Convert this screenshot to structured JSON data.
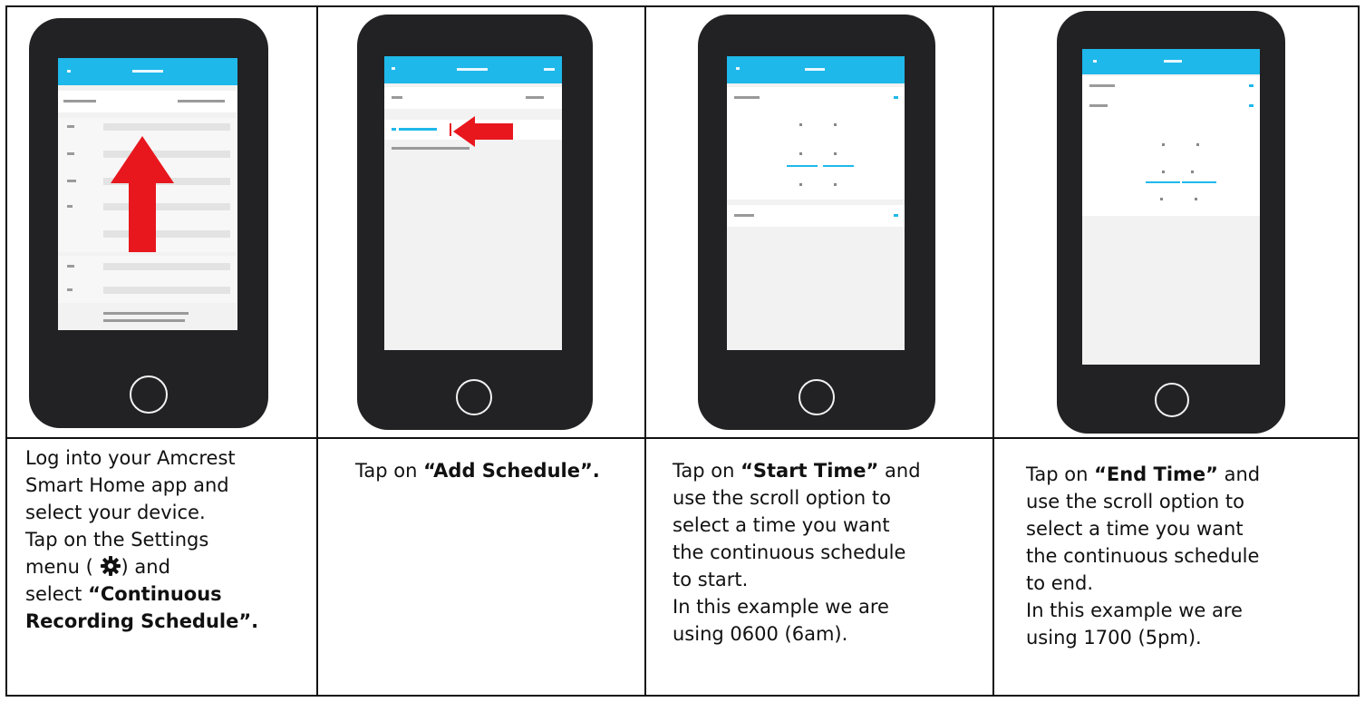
{
  "steps": [
    {
      "caption_lines": [
        [
          "Log into your Amcrest",
          ""
        ],
        [
          "Smart Home app and",
          ""
        ],
        [
          "select your device.",
          ""
        ],
        [
          "Tap on the Settings",
          ""
        ],
        [
          "menu ( ",
          "",
          "gear",
          ") and"
        ],
        [
          "select ",
          "“Continuous"
        ],
        [
          "",
          "Recording Schedule”."
        ]
      ]
    },
    {
      "caption_lines": [
        [
          "Tap on ",
          "“Add Schedule”."
        ]
      ]
    },
    {
      "caption_lines": [
        [
          "Tap on ",
          "“Start Time”",
          " and"
        ],
        [
          "use the scroll option to",
          ""
        ],
        [
          "select a time you want",
          ""
        ],
        [
          "the continuous schedule",
          ""
        ],
        [
          "to start.",
          ""
        ],
        [
          "In this example we are",
          ""
        ],
        [
          "using 0600 (6am).",
          ""
        ]
      ]
    },
    {
      "caption_lines": [
        [
          "Tap on ",
          "“End Time”",
          " and"
        ],
        [
          "use the scroll option to",
          ""
        ],
        [
          "select a time you want",
          ""
        ],
        [
          "the continuous schedule",
          ""
        ],
        [
          "to end.",
          ""
        ],
        [
          "In this example we are",
          ""
        ],
        [
          "using 1700 (5pm).",
          ""
        ]
      ]
    }
  ],
  "icons": {
    "gear": "gear-icon",
    "arrow_up": "red-arrow-up-icon",
    "arrow_left": "red-arrow-left-icon",
    "home": "home-button-icon"
  },
  "colors": {
    "app_header": "#1fb8ea",
    "arrow": "#e8171e",
    "phone_body": "#222224",
    "border": "#111111"
  }
}
